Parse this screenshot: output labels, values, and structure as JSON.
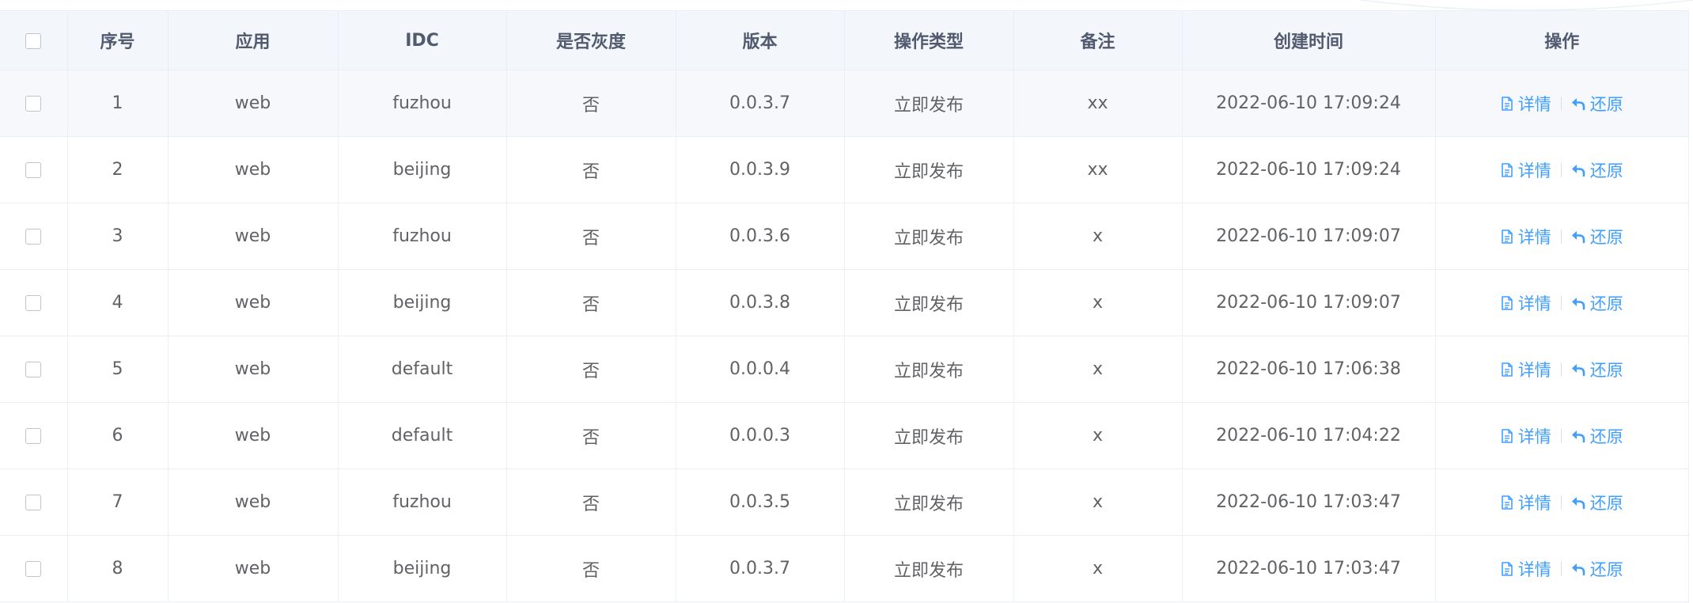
{
  "table": {
    "columns": [
      "序号",
      "应用",
      "IDC",
      "是否灰度",
      "版本",
      "操作类型",
      "备注",
      "创建时间",
      "操作"
    ],
    "rows": [
      {
        "index": "1",
        "app": "web",
        "idc": "fuzhou",
        "gray": "否",
        "version": "0.0.3.7",
        "op_type": "立即发布",
        "remark": "xx",
        "created": "2022-06-10 17:09:24"
      },
      {
        "index": "2",
        "app": "web",
        "idc": "beijing",
        "gray": "否",
        "version": "0.0.3.9",
        "op_type": "立即发布",
        "remark": "xx",
        "created": "2022-06-10 17:09:24"
      },
      {
        "index": "3",
        "app": "web",
        "idc": "fuzhou",
        "gray": "否",
        "version": "0.0.3.6",
        "op_type": "立即发布",
        "remark": "x",
        "created": "2022-06-10 17:09:07"
      },
      {
        "index": "4",
        "app": "web",
        "idc": "beijing",
        "gray": "否",
        "version": "0.0.3.8",
        "op_type": "立即发布",
        "remark": "x",
        "created": "2022-06-10 17:09:07"
      },
      {
        "index": "5",
        "app": "web",
        "idc": "default",
        "gray": "否",
        "version": "0.0.0.4",
        "op_type": "立即发布",
        "remark": "x",
        "created": "2022-06-10 17:06:38"
      },
      {
        "index": "6",
        "app": "web",
        "idc": "default",
        "gray": "否",
        "version": "0.0.0.3",
        "op_type": "立即发布",
        "remark": "x",
        "created": "2022-06-10 17:04:22"
      },
      {
        "index": "7",
        "app": "web",
        "idc": "fuzhou",
        "gray": "否",
        "version": "0.0.3.5",
        "op_type": "立即发布",
        "remark": "x",
        "created": "2022-06-10 17:03:47"
      },
      {
        "index": "8",
        "app": "web",
        "idc": "beijing",
        "gray": "否",
        "version": "0.0.3.7",
        "op_type": "立即发布",
        "remark": "x",
        "created": "2022-06-10 17:03:47"
      }
    ],
    "actions": {
      "detail_label": "详情",
      "detail_icon": "document-icon",
      "restore_label": "还原",
      "restore_icon": "undo-arrow-icon"
    }
  },
  "colors": {
    "header_bg": "#f3f6fa",
    "header_text": "#515a6e",
    "cell_text": "#606266",
    "border": "#ebeef5",
    "link": "#409eff",
    "hover_row_bg": "#f6f8fb"
  }
}
